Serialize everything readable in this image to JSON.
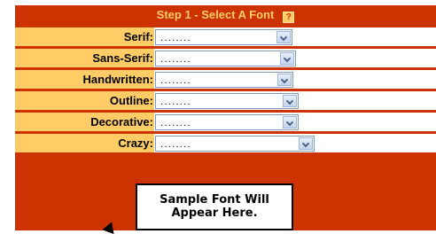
{
  "header": {
    "title": "Step 1 - Select A Font",
    "help_icon": "?"
  },
  "rows": [
    {
      "label": "Serif:",
      "value": "........"
    },
    {
      "label": "Sans-Serif:",
      "value": "........"
    },
    {
      "label": "Handwritten:",
      "value": "........"
    },
    {
      "label": "Outline:",
      "value": "........"
    },
    {
      "label": "Decorative:",
      "value": "........"
    },
    {
      "label": "Crazy:",
      "value": "........"
    }
  ],
  "sample": {
    "line1": "Sample Font Will",
    "line2": "Appear Here."
  },
  "colors": {
    "panel": "#cc3300",
    "label_bg": "#ffcc66",
    "header_text": "#ffcc66"
  }
}
